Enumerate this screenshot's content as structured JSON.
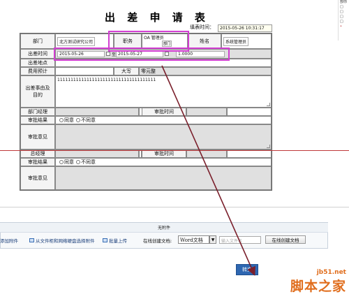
{
  "form": {
    "title": "出 差 申 请 表",
    "fill_time_label": "填表时间：",
    "fill_time_value": "2015-05-26 10:31:17",
    "dept_label": "部门",
    "dept_value": "北方测试研究公司",
    "position_label": "职务",
    "position_value": "OA 管理员",
    "position_extra": "部门",
    "name_label": "姓名",
    "name_value": "系统管理员",
    "trip_time_label": "出差时间",
    "start_date": "2015-05-26",
    "to_label": "至",
    "end_date": "2015-05-27",
    "days_value": "1.0000",
    "place_label": "出差地点",
    "place_value": "",
    "budget_label": "费用预计",
    "budget_value": "",
    "capital_label": "大写",
    "capital_value": "零元整",
    "reason_label": "出差事由及目的",
    "reason_value": "1111111111111111111111111111111111111",
    "dept_manager_label": "部门经理",
    "dept_manager_value": "",
    "approve_time_label": "审批时间",
    "approve_time_value": "",
    "approve_result_label": "审批结果",
    "agree_label": "同意",
    "disagree_label": "不同意",
    "approve_opinion_label": "审批意见",
    "gm_label": "总经理",
    "gm_value": "",
    "gm_approve_time_label": "审批时间",
    "gm_approve_time_value": "",
    "gm_result_label": "审批结果",
    "gm_agree_label": "同意",
    "gm_disagree_label": "不同意",
    "gm_opinion_label": "审批意见"
  },
  "attachments": {
    "empty_label": "无附件",
    "add_label": "添加附件",
    "from_cabinet_label": "从文件柜和网络硬盘选择附件",
    "batch_upload_label": "批量上传",
    "online_create_label": "在线创建文档:",
    "doc_type_value": "Word文档",
    "doc_name_placeholder": "输入文件名",
    "online_create_button": "在线创建文档"
  },
  "actions": {
    "submit_label": "转交"
  },
  "side_panel": {
    "lines": [
      "部你",
      "□",
      "□",
      "□",
      "□",
      "•"
    ]
  },
  "watermark": {
    "line1": "jb51.net",
    "line2": "脚本之家"
  },
  "colors": {
    "highlight": "#d23fd2",
    "arrow": "#7a1f2b",
    "red_line": "#c0393b",
    "submit_bg": "#2e67b1",
    "watermark": "#e06d1c"
  }
}
